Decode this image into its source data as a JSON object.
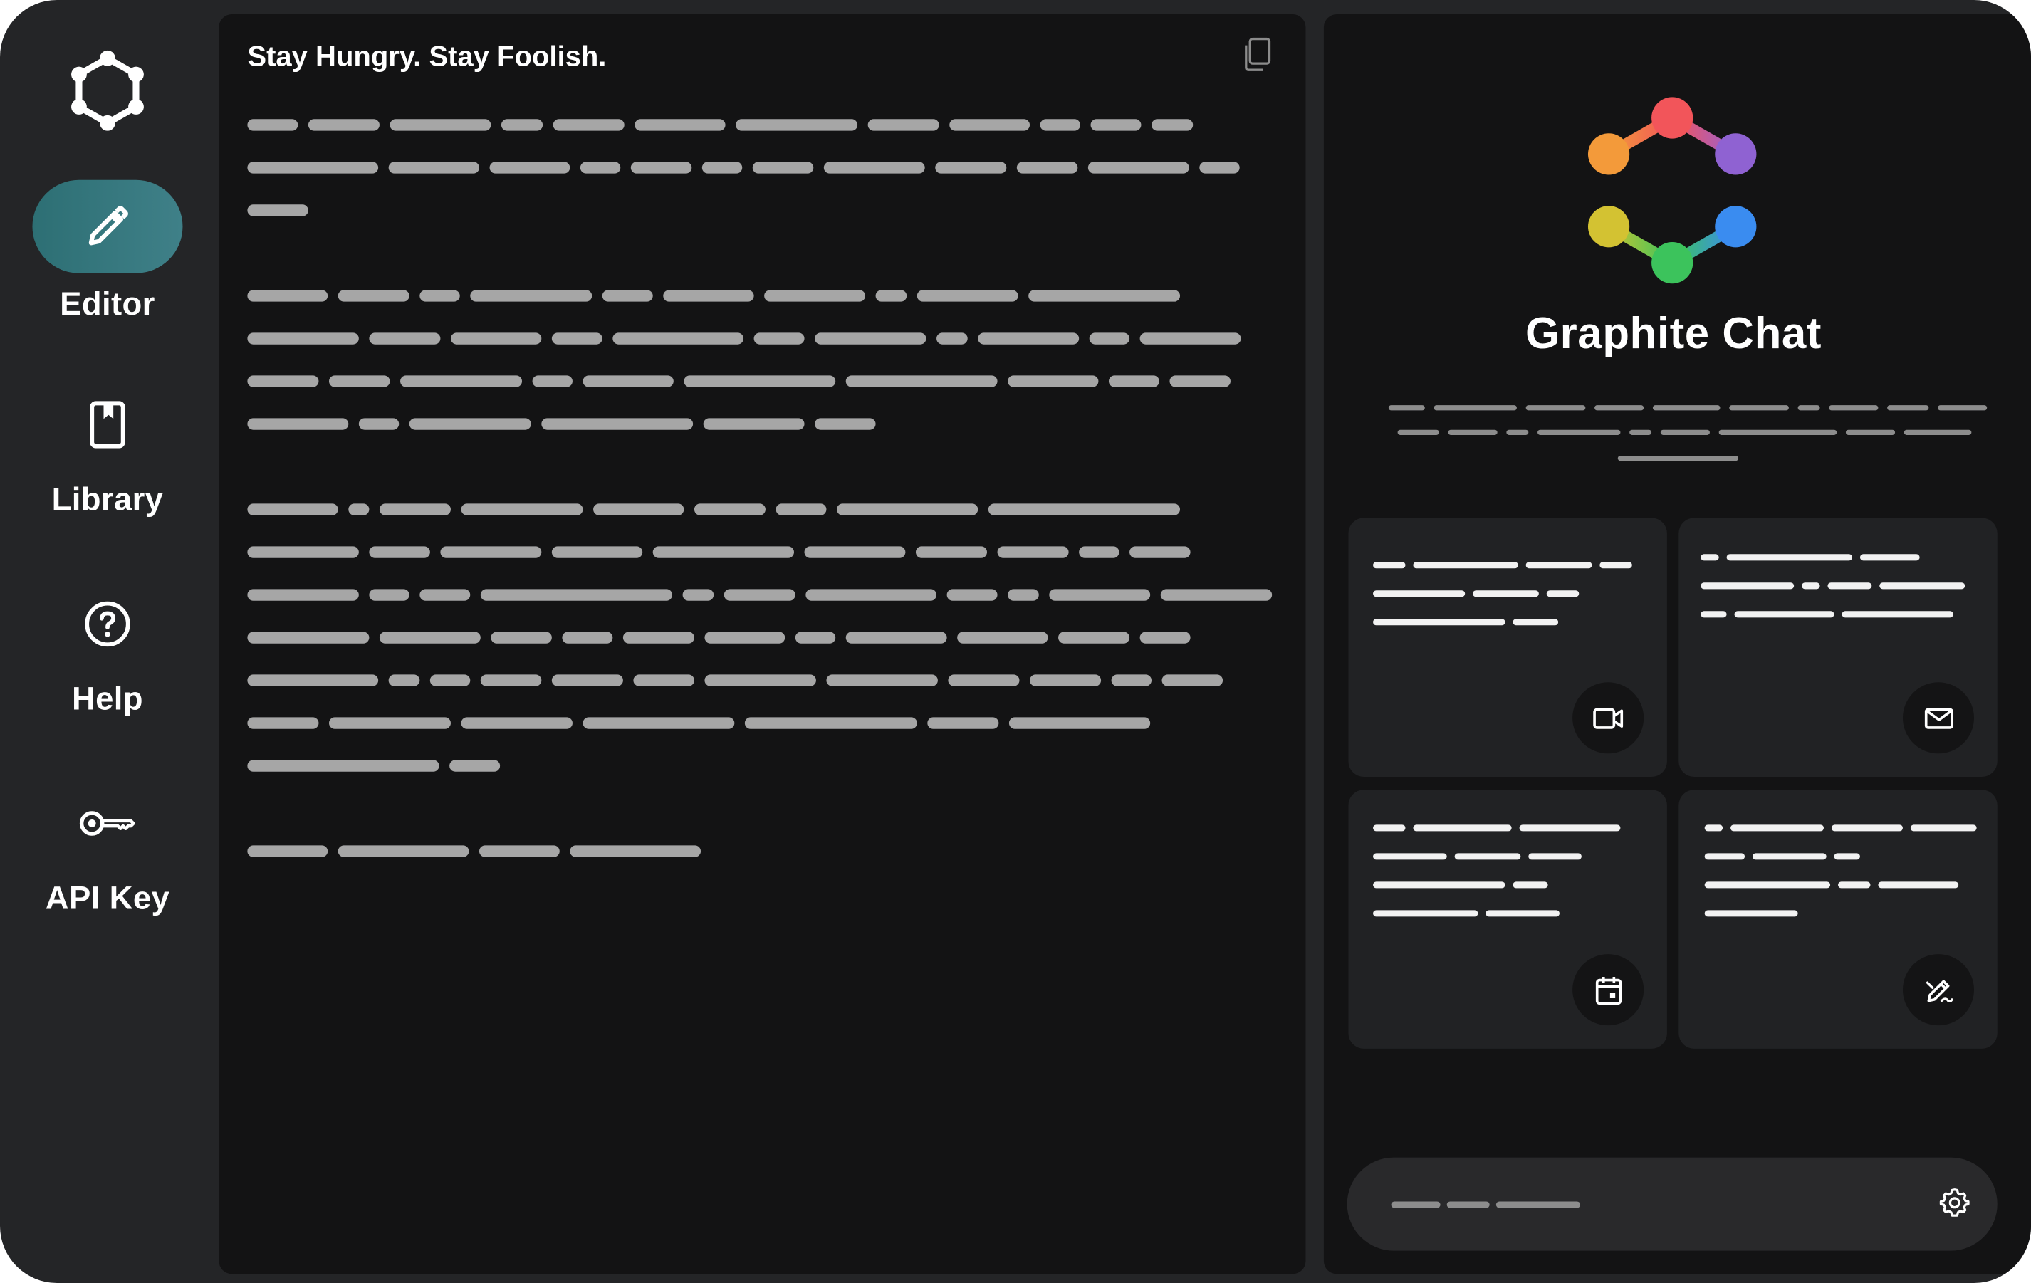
{
  "app": {
    "name": "Graphite Chat",
    "accent_color": "#3a7b82"
  },
  "sidebar": {
    "logo_icon": "graphite-hexagon-icon",
    "items": [
      {
        "label": "Editor",
        "icon": "pencil-icon",
        "active": true
      },
      {
        "label": "Library",
        "icon": "bookmark-icon",
        "active": false
      },
      {
        "label": "Help",
        "icon": "help-circle-icon",
        "active": false
      },
      {
        "label": "API Key",
        "icon": "key-icon",
        "active": false
      }
    ]
  },
  "editor": {
    "title": "Stay Hungry. Stay Foolish.",
    "copy_icon": "copy-icon"
  },
  "chat": {
    "logo_icon": "graphite-hexagon-gradient-icon",
    "title": "Graphite Chat",
    "cards": [
      {
        "icon": "video-camera-icon"
      },
      {
        "icon": "mail-icon"
      },
      {
        "icon": "calendar-icon"
      },
      {
        "icon": "edit-pen-icon"
      }
    ],
    "settings_icon": "gear-icon"
  }
}
